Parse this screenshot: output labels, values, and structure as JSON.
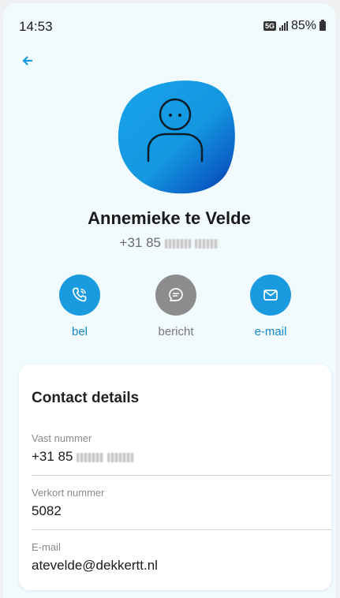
{
  "status_bar": {
    "time": "14:53",
    "network": "5G",
    "battery": "85%"
  },
  "contact": {
    "name": "Annemieke te Velde",
    "phone_prefix": "+31 85"
  },
  "actions": [
    {
      "label": "bel",
      "icon": "phone-icon"
    },
    {
      "label": "bericht",
      "icon": "message-icon"
    },
    {
      "label": "e-mail",
      "icon": "mail-icon"
    }
  ],
  "details": {
    "title": "Contact details",
    "fields": [
      {
        "label": "Vast nummer",
        "value": "+31 85"
      },
      {
        "label": "Verkort nummer",
        "value": "5082"
      },
      {
        "label": "E-mail",
        "value": "atevelde@dekkertt.nl"
      }
    ]
  },
  "colors": {
    "accent": "#1a9be0",
    "background": "#f1fafd",
    "muted": "#8c8c8c"
  }
}
